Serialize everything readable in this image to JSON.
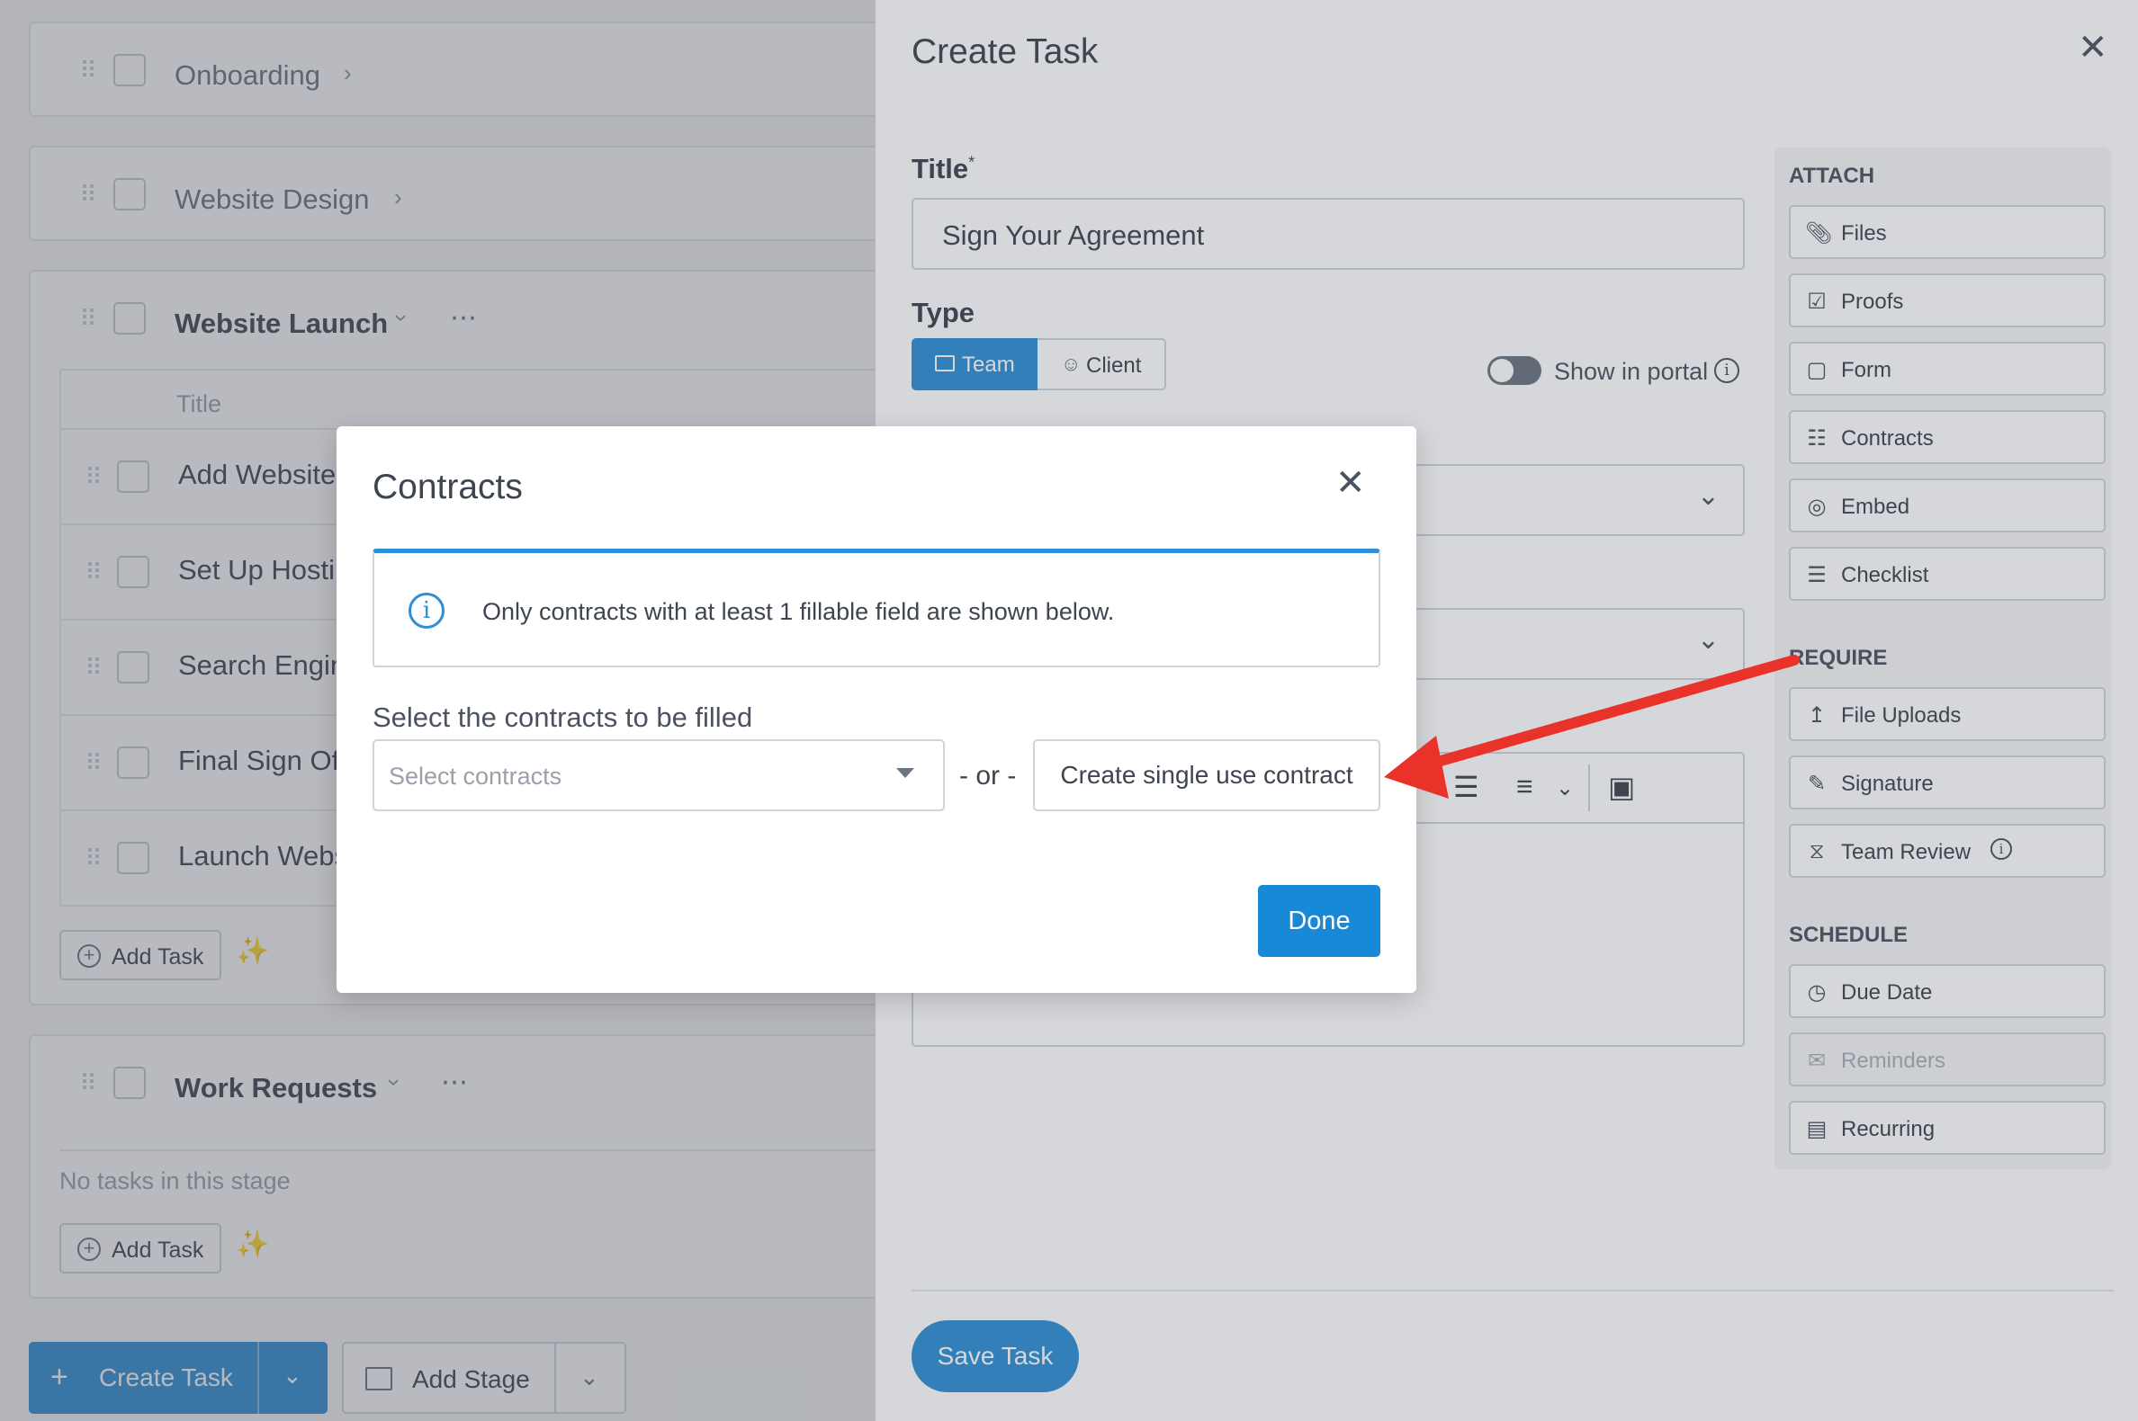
{
  "board": {
    "stages": [
      {
        "name": "Onboarding"
      },
      {
        "name": "Website Design"
      },
      {
        "name": "Website Launch"
      },
      {
        "name": "Work Requests"
      }
    ],
    "table_header": "Title",
    "tasks": [
      "Add Website",
      "Set Up Hosti",
      "Search Engin",
      "Final Sign Of",
      "Launch Webs"
    ],
    "add_task_label": "Add Task",
    "no_tasks_text": "No tasks in this stage",
    "create_task_label": "Create Task",
    "add_stage_label": "Add Stage"
  },
  "panel": {
    "title": "Create Task",
    "title_label": "Title",
    "required_mark": "*",
    "title_value": "Sign Your Agreement",
    "type_label": "Type",
    "type_options": [
      "Team",
      "Client"
    ],
    "show_in_portal": "Show in portal",
    "save_label": "Save Task",
    "sidebar": {
      "attach_heading": "ATTACH",
      "attach": [
        {
          "label": "Files",
          "icon": "paperclip-icon"
        },
        {
          "label": "Proofs",
          "icon": "checkbox-icon"
        },
        {
          "label": "Form",
          "icon": "form-icon"
        },
        {
          "label": "Contracts",
          "icon": "document-icon"
        },
        {
          "label": "Embed",
          "icon": "globe-icon"
        },
        {
          "label": "Checklist",
          "icon": "list-icon"
        }
      ],
      "require_heading": "REQUIRE",
      "require": [
        {
          "label": "File Uploads",
          "icon": "upload-icon"
        },
        {
          "label": "Signature",
          "icon": "pen-icon"
        },
        {
          "label": "Team Review",
          "icon": "hourglass-icon"
        }
      ],
      "schedule_heading": "SCHEDULE",
      "schedule": [
        {
          "label": "Due Date",
          "icon": "clock-icon"
        },
        {
          "label": "Reminders",
          "icon": "envelope-icon",
          "disabled": true
        },
        {
          "label": "Recurring",
          "icon": "calendar-icon"
        }
      ]
    }
  },
  "modal": {
    "title": "Contracts",
    "notice": "Only contracts with at least 1 fillable field are shown below.",
    "select_label": "Select the contracts to be filled",
    "select_placeholder": "Select contracts",
    "or_text": "- or -",
    "single_use_label": "Create single use contract",
    "done_label": "Done"
  },
  "colors": {
    "accent": "#2d8fd5",
    "arrow": "#e8322a"
  }
}
